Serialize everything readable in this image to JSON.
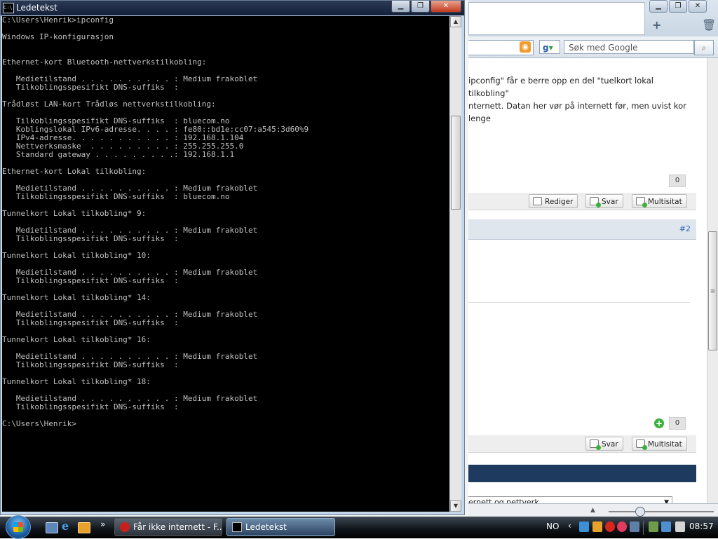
{
  "console": {
    "title": "Ledetekst",
    "icon_label": "C:\\",
    "buttons": {
      "minimize": "▁",
      "maximize": "❐",
      "close": "✕"
    },
    "lines": [
      "C:\\Users\\Henrik>ipconfig",
      "",
      "Windows IP-konfigurasjon",
      "",
      "",
      "Ethernet-kort Bluetooth-nettverkstilkobling:",
      "",
      "   Medietilstand . . . . . . . . . . : Medium frakoblet",
      "   Tilkoblingsspesifikt DNS-suffiks  :",
      "",
      "Trådløst LAN-kort Trådløs nettverkstilkobling:",
      "",
      "   Tilkoblingsspesifikt DNS-suffiks  : bluecom.no",
      "   Koblingslokal IPv6-adresse. . . . : fe80::bd1e:cc07:a545:3d60%9",
      "   IPv4-adresse. . . . . . . . . . . : 192.168.1.104",
      "   Nettverksmaske  . . . . . . . . . : 255.255.255.0",
      "   Standard gateway . . . . . . . . .: 192.168.1.1",
      "",
      "Ethernet-kort Lokal tilkobling:",
      "",
      "   Medietilstand . . . . . . . . . . : Medium frakoblet",
      "   Tilkoblingsspesifikt DNS-suffiks  : bluecom.no",
      "",
      "Tunnelkort Lokal tilkobling* 9:",
      "",
      "   Medietilstand . . . . . . . . . . : Medium frakoblet",
      "   Tilkoblingsspesifikt DNS-suffiks  :",
      "",
      "Tunnelkort Lokal tilkobling* 10:",
      "",
      "   Medietilstand . . . . . . . . . . : Medium frakoblet",
      "   Tilkoblingsspesifikt DNS-suffiks  :",
      "",
      "Tunnelkort Lokal tilkobling* 14:",
      "",
      "   Medietilstand . . . . . . . . . . : Medium frakoblet",
      "   Tilkoblingsspesifikt DNS-suffiks  :",
      "",
      "Tunnelkort Lokal tilkobling* 16:",
      "",
      "   Medietilstand . . . . . . . . . . : Medium frakoblet",
      "   Tilkoblingsspesifikt DNS-suffiks  :",
      "",
      "Tunnelkort Lokal tilkobling* 18:",
      "",
      "   Medietilstand . . . . . . . . . . : Medium frakoblet",
      "   Tilkoblingsspesifikt DNS-suffiks  :",
      "",
      "C:\\Users\\Henrik>"
    ]
  },
  "browser": {
    "window_buttons": {
      "minimize": "▁",
      "maximize": "❐",
      "close": "✕"
    },
    "toolbar_icons": {
      "new_tab": "+",
      "trash": "🗑"
    },
    "search_placeholder": "Søk med Google",
    "google_letters": [
      "g",
      "▾"
    ],
    "post_text_1": "ipconfig\" får e berre opp en del \"tuelkort lokal tilkobling\"",
    "post_text_2": "nternett. Datan her vør på internett før, men uvist kor lenge",
    "post1_count": "0",
    "edit_label": "Rediger",
    "reply_label": "Svar",
    "multiquote_label": "Multisitat",
    "post2_number": "#2",
    "post2_count": "0",
    "forum_select_value": "ernett og nettverk"
  },
  "taskbar": {
    "quick_launch_more": "»",
    "firefox_task": "Får ikke internett - F...",
    "cmd_task": "Ledetekst",
    "language": "NO",
    "tray_arrow": "‹",
    "clock": "08:57"
  }
}
